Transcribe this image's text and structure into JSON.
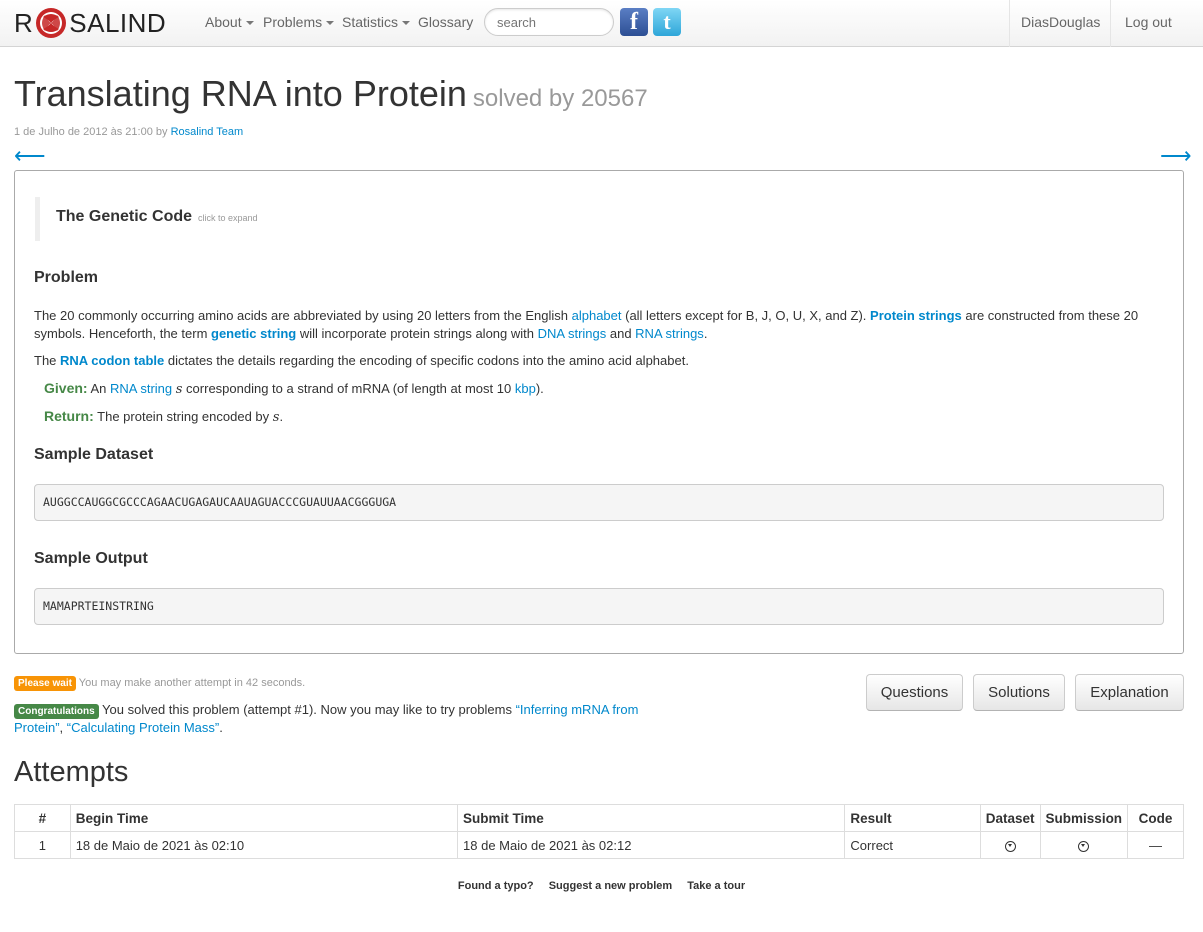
{
  "nav": {
    "brand_left": "R",
    "brand_right": "SALIND",
    "items": [
      {
        "label": "About",
        "has_caret": true
      },
      {
        "label": "Problems",
        "has_caret": true
      },
      {
        "label": "Statistics",
        "has_caret": true
      },
      {
        "label": "Glossary",
        "has_caret": false
      }
    ],
    "search_placeholder": "search",
    "facebook_glyph": "f",
    "twitter_glyph": "t",
    "user": "DiasDouglas",
    "logout": "Log out"
  },
  "header": {
    "title": "Translating RNA into Protein",
    "solved_by": "solved by 20567",
    "date": "1 de Julho de 2012 às 21:00 by",
    "author": "Rosalind Team",
    "prev_arrow": "⟵",
    "next_arrow": "⟶"
  },
  "problem": {
    "genetic_code_title": "The Genetic Code",
    "genetic_code_hint": "click to expand",
    "problem_heading": "Problem",
    "p1": {
      "t1": "The 20 commonly occurring amino acids are abbreviated by using 20 letters from the English ",
      "l1": "alphabet",
      "t2": " (all letters except for B, J, O, U, X, and Z). ",
      "l2": "Protein strings",
      "t3": " are constructed from these 20 symbols. Henceforth, the term ",
      "l3": "genetic string",
      "t4": " will incorporate protein strings along with ",
      "l4": "DNA strings",
      "t5": " and ",
      "l5": "RNA strings",
      "t6": "."
    },
    "p2": {
      "t1": "The ",
      "l1": "RNA codon table",
      "t2": " dictates the details regarding the encoding of specific codons into the amino acid alphabet."
    },
    "given": {
      "label": "Given:",
      "t1": " An ",
      "l1": "RNA string",
      "var": "s",
      "t2": " corresponding to a strand of mRNA (of length at most 10 ",
      "l2": "kbp",
      "t3": ")."
    },
    "return": {
      "label": "Return:",
      "t1": " The protein string encoded by ",
      "var": "s",
      "t2": "."
    },
    "sample_dataset_heading": "Sample Dataset",
    "sample_dataset": "AUGGCCAUGGCGCCCAGAACUGAGAUCAAUAGUACCCGUAUUAACGGGUGA",
    "sample_output_heading": "Sample Output",
    "sample_output": "MAMAPRTEINSTRING"
  },
  "status": {
    "wait_label": "Please wait",
    "wait_text": "You may make another attempt in 42 seconds.",
    "congrats_label": "Congratulations",
    "congrats_t1": " You solved this problem (attempt #1). Now you may like to try problems ",
    "congrats_l1": "“Inferring mRNA from Protein”",
    "congrats_t2": ", ",
    "congrats_l2": "“Calculating Protein Mass”",
    "congrats_t3": "."
  },
  "buttons": {
    "questions": "Questions",
    "solutions": "Solutions",
    "explanation": "Explanation"
  },
  "attempts": {
    "title": "Attempts",
    "headers": [
      "#",
      "Begin Time",
      "Submit Time",
      "Result",
      "Dataset",
      "Submission",
      "Code"
    ],
    "rows": [
      {
        "num": "1",
        "begin": "18 de Maio de 2021 às 02:10",
        "submit": "18 de Maio de 2021 às 02:12",
        "result": "Correct",
        "code": "—"
      }
    ]
  },
  "footer": {
    "typo": "Found a typo?",
    "suggest": "Suggest a new problem",
    "tour": "Take a tour"
  }
}
